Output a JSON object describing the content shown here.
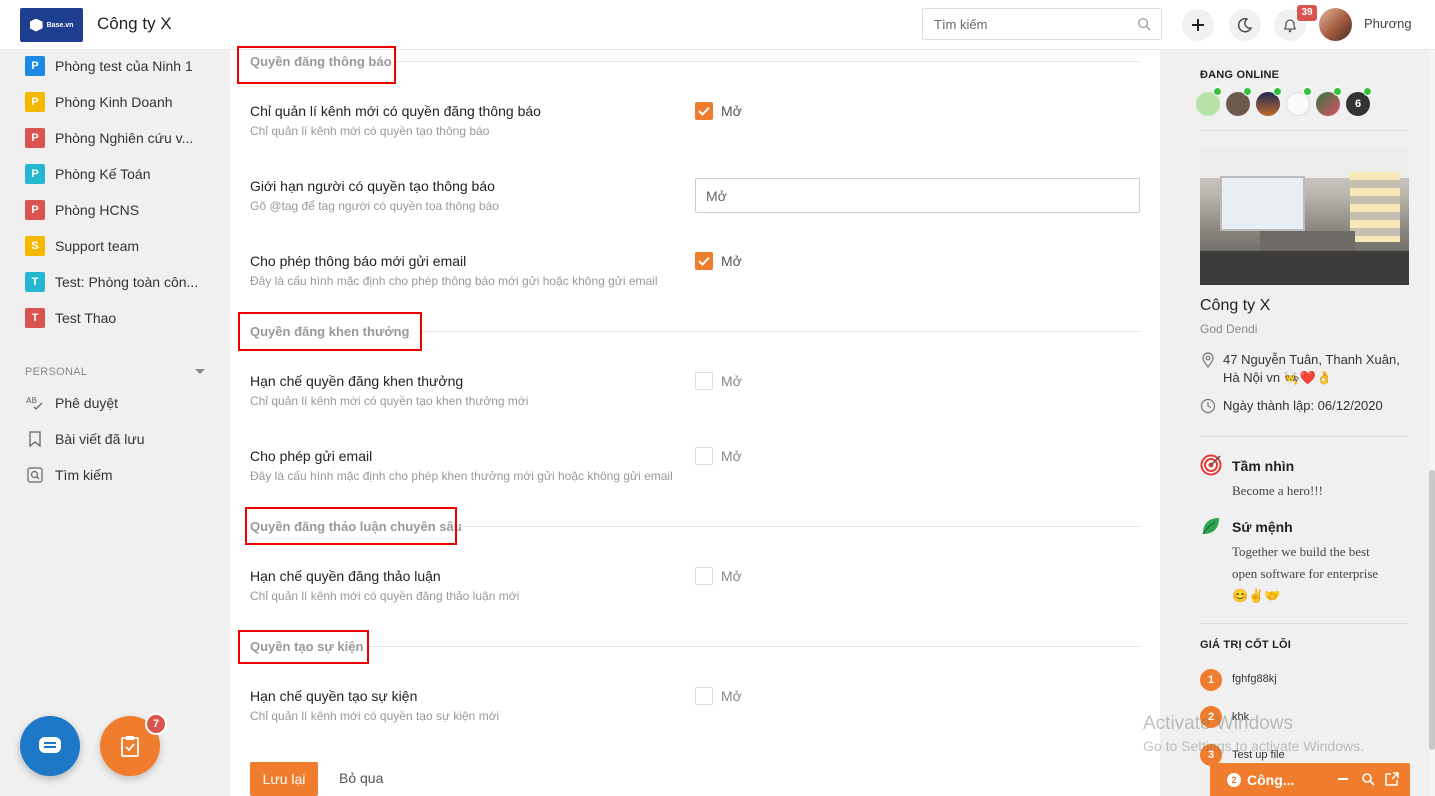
{
  "header": {
    "logo_text": "Base.vn",
    "company_name": "Công ty X",
    "search_placeholder": "Tìm kiếm",
    "notification_count": "39",
    "user_name": "Phương"
  },
  "sidebar": {
    "groups": [
      {
        "badge": "P",
        "label": "Phòng test của Ninh 1",
        "color": "#1e88e5"
      },
      {
        "badge": "P",
        "label": "Phòng Kinh Doanh",
        "color": "#f5b800"
      },
      {
        "badge": "P",
        "label": "Phòng Nghiên cứu v...",
        "color": "#d9534f"
      },
      {
        "badge": "P",
        "label": "Phòng Kế Toán",
        "color": "#26b6d1"
      },
      {
        "badge": "P",
        "label": "Phòng HCNS",
        "color": "#d9534f"
      },
      {
        "badge": "S",
        "label": "Support team",
        "color": "#f5b800"
      },
      {
        "badge": "T",
        "label": "Test: Phòng toàn côn...",
        "color": "#26b6d1"
      },
      {
        "badge": "T",
        "label": "Test Thao",
        "color": "#d9534f"
      }
    ],
    "personal_header": "PERSONAL",
    "personal_items": [
      {
        "label": "Phê duyệt"
      },
      {
        "label": "Bài viết đã lưu"
      },
      {
        "label": "Tìm kiếm"
      }
    ],
    "task_badge": "7"
  },
  "main": {
    "sections": [
      {
        "title": "Quyền đăng thông báo"
      },
      {
        "title": "Quyền đăng khen thưởng"
      },
      {
        "title": "Quyền đăng thảo luận chuyên sâu"
      },
      {
        "title": "Quyền tạo sự kiện"
      }
    ],
    "settings": [
      {
        "title": "Chỉ quản lí kênh mới có quyền đăng thông báo",
        "desc": "Chỉ quản lí kênh mới có quyền tạo thông báo",
        "checked": true,
        "label": "Mở"
      },
      {
        "title": "Giới hạn người có quyền tạo thông báo",
        "desc": "Gõ @tag để tag người có quyền tọa thông báo",
        "input_value": "Mở"
      },
      {
        "title": "Cho phép thông báo mới gửi email",
        "desc": "Đây là cấu hình mặc định cho phép thông báo mới gửi hoặc không gửi email",
        "checked": true,
        "label": "Mở"
      },
      {
        "title": "Hạn chế quyền đăng khen thưởng",
        "desc": "Chỉ quản lí kênh mới có quyền tạo khen thưởng mới",
        "checked": false,
        "label": "Mở"
      },
      {
        "title": "Cho phép gửi email",
        "desc": "Đây là cấu hình mặc định cho phép khen thưởng mới gửi hoặc không gửi email",
        "checked": false,
        "label": "Mở"
      },
      {
        "title": "Hạn chế quyền đăng thảo luận",
        "desc": "Chỉ quản lí kênh mới có quyền đăng thảo luận mới",
        "checked": false,
        "label": "Mở"
      },
      {
        "title": "Hạn chế quyền tạo sự kiện",
        "desc": "Chỉ quản lí kênh mới có quyền tạo sự kiện mới",
        "checked": false,
        "label": "Mở"
      }
    ],
    "save_label": "Lưu lại",
    "skip_label": "Bỏ qua"
  },
  "right_panel": {
    "online_header": "ĐANG ONLINE",
    "online_more": "6",
    "company_name": "Công ty X",
    "company_sub": "God Dendi",
    "address_line1": "47 Nguyễn Tuân, Thanh Xuân,",
    "address_line2": "Hà Nội vn 🧑‍🍳❤️👌",
    "founded": "Ngày thành lập: 06/12/2020",
    "vision_title": "Tầm nhìn",
    "vision_text": "Become a hero!!!",
    "mission_title": "Sứ mệnh",
    "mission_line1": "Together we build the best",
    "mission_line2": "open software for enterprise",
    "mission_line3": "😊✌️🤝",
    "core_values_header": "GIÁ TRỊ CỐT LÕI",
    "core_values": [
      {
        "num": "1",
        "label": "fghfg88kj"
      },
      {
        "num": "2",
        "label": "khk"
      },
      {
        "num": "3",
        "label": "Test up file"
      }
    ]
  },
  "chat_bar": {
    "count": "2",
    "title": "Công..."
  },
  "watermark": {
    "line1": "Activate Windows",
    "line2": "Go to Settings to activate Windows."
  }
}
